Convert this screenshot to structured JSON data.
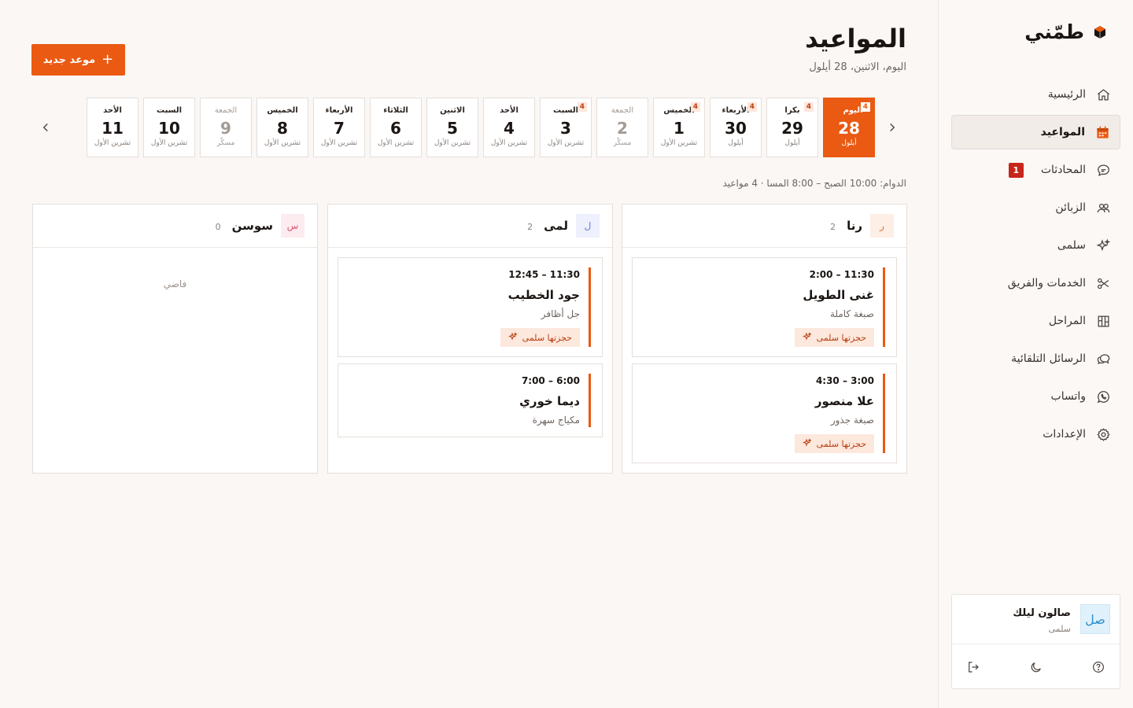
{
  "sidebar": {
    "brand": "طمّني",
    "items": [
      {
        "label": "الرئيسية",
        "icon": "home-icon"
      },
      {
        "label": "المواعيد",
        "icon": "calendar-icon",
        "active": true
      },
      {
        "label": "المحادثات",
        "icon": "chat-icon",
        "badge": "1"
      },
      {
        "label": "الزبائن",
        "icon": "users-icon"
      },
      {
        "label": "سلمى",
        "icon": "sparkle-icon"
      },
      {
        "label": "الخدمات والفريق",
        "icon": "scissors-icon"
      },
      {
        "label": "المراحل",
        "icon": "kanban-icon"
      },
      {
        "label": "الرسائل التلقائية",
        "icon": "messages-icon"
      },
      {
        "label": "واتساب",
        "icon": "whatsapp-icon"
      },
      {
        "label": "الإعدادات",
        "icon": "gear-icon"
      }
    ],
    "account": {
      "avatar": "صل",
      "name": "صالون ليلك",
      "sub": "سلمى"
    }
  },
  "header": {
    "title": "المواعيد",
    "date": "اليوم، الاثنين، 28 أيلول",
    "new_button": "موعد جديد"
  },
  "days": [
    {
      "name": "اليوم",
      "num": "28",
      "month": "أيلول",
      "count": "4",
      "today": true
    },
    {
      "name": "بكرا",
      "num": "29",
      "month": "أيلول",
      "count": "4"
    },
    {
      "name": "الأربعاء",
      "num": "30",
      "month": "أيلول",
      "count": "4"
    },
    {
      "name": "الخميس",
      "num": "1",
      "month": "تشرين الأول",
      "count": "4"
    },
    {
      "name": "الجمعة",
      "num": "2",
      "month": "مسكّر",
      "closed": true
    },
    {
      "name": "السبت",
      "num": "3",
      "month": "تشرين الأول",
      "count": "4"
    },
    {
      "name": "الأحد",
      "num": "4",
      "month": "تشرين الأول"
    },
    {
      "name": "الاثنين",
      "num": "5",
      "month": "تشرين الأول"
    },
    {
      "name": "الثلاثاء",
      "num": "6",
      "month": "تشرين الأول"
    },
    {
      "name": "الأربعاء",
      "num": "7",
      "month": "تشرين الأول"
    },
    {
      "name": "الخميس",
      "num": "8",
      "month": "تشرين الأول"
    },
    {
      "name": "الجمعة",
      "num": "9",
      "month": "مسكّر",
      "closed": true
    },
    {
      "name": "السبت",
      "num": "10",
      "month": "تشرين الأول"
    },
    {
      "name": "الأحد",
      "num": "11",
      "month": "تشرين الأول"
    }
  ],
  "hours_line": "الدوام: 10:00 الصبح – 8:00 المسا · 4 مواعيد",
  "staff": [
    {
      "initial": "ر",
      "name": "رنا",
      "count": "2",
      "avatar_bg": "#fdeee6",
      "avatar_fg": "#e0703a",
      "appointments": [
        {
          "time": "2:00 – 11:30",
          "customer": "غنى الطويل",
          "service": "صبغة كاملة",
          "tag": "حجزتها سلمى"
        },
        {
          "time": "4:30 – 3:00",
          "customer": "علا منصور",
          "service": "صبغة جذور",
          "tag": "حجزتها سلمى"
        }
      ]
    },
    {
      "initial": "ل",
      "name": "لمى",
      "count": "2",
      "avatar_bg": "#eef0fd",
      "avatar_fg": "#6d7ad9",
      "appointments": [
        {
          "time": "12:45 – 11:30",
          "customer": "جود الخطيب",
          "service": "جل أظافر",
          "tag": "حجزتها سلمى"
        },
        {
          "time": "7:00 – 6:00",
          "customer": "ديما خوري",
          "service": "مكياج سهرة",
          "tag": ""
        }
      ]
    },
    {
      "initial": "س",
      "name": "سوسن",
      "count": "0",
      "avatar_bg": "#fdecef",
      "avatar_fg": "#d9566f",
      "empty": "فاضي",
      "appointments": []
    }
  ],
  "colors": {
    "accent": "#ea5a12",
    "badge": "#c7261c"
  }
}
